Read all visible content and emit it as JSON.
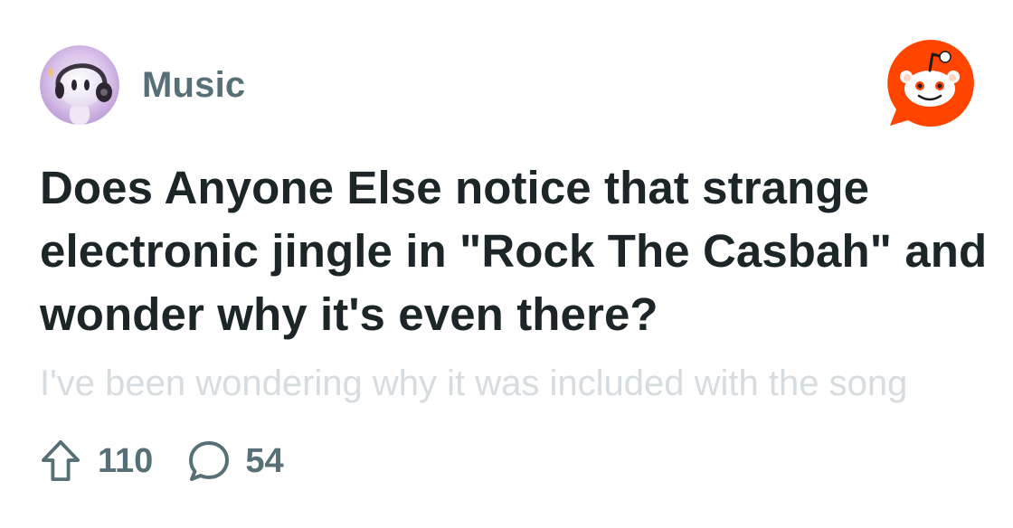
{
  "post": {
    "subreddit": "Music",
    "title": "Does Anyone Else notice that strange electronic jingle in \"Rock The Casbah\" and wonder why it's even there?",
    "excerpt": "I've been wondering why it was included with the song",
    "upvotes": "110",
    "comments": "54"
  },
  "icons": {
    "avatar": "subreddit-avatar-headphones-character",
    "logo": "reddit-snoo-logo",
    "upvote": "upvote-arrow-icon",
    "comment": "comment-bubble-icon"
  },
  "colors": {
    "reddit_orange": "#ff4500",
    "title_text": "#1c2528",
    "meta_text": "#576f76",
    "excerpt_text": "#d6dcdf"
  }
}
